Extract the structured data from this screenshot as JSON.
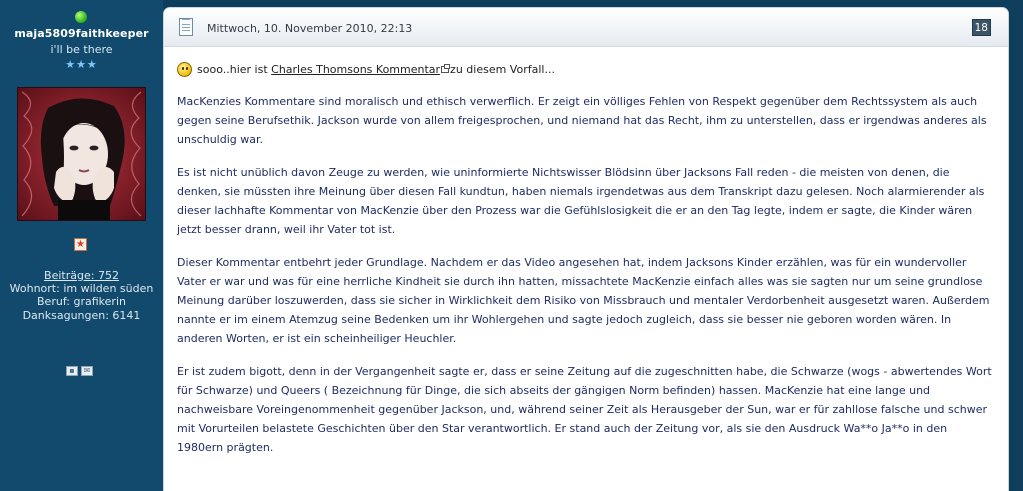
{
  "user": {
    "username": "maja5809faithkeeper",
    "title": "i'll be there",
    "stars": "★★★",
    "posts_label": "Beiträge: 752",
    "location_label": "Wohnort: im wilden süden",
    "job_label": "Beruf: grafikerin",
    "thanks_label": "Danksagungen: 6141",
    "icons": [
      "profile-icon",
      "mail-icon"
    ]
  },
  "post": {
    "date": "Mittwoch, 10. November 2010, 22:13",
    "number": "18",
    "intro_before": "sooo..hier ist ",
    "intro_link": "Charles Thomsons Kommentar",
    "intro_after": "zu diesem Vorfall...",
    "paragraphs": [
      "MacKenzies Kommentare sind moralisch und ethisch verwerflich. Er zeigt ein völliges Fehlen von Respekt gegenüber dem Rechtssystem als auch gegen seine Berufsethik. Jackson wurde von allem freigesprochen, und niemand hat das Recht, ihm zu unterstellen, dass er irgendwas anderes als unschuldig war.",
      "Es ist nicht unüblich davon Zeuge zu werden, wie uninformierte Nichtswisser Blödsinn über Jacksons Fall reden - die meisten von denen, die denken, sie müssten ihre Meinung über diesen Fall kundtun, haben niemals irgendetwas aus dem Transkript dazu gelesen. Noch alarmierender als dieser lachhafte Kommentar von MacKenzie über den Prozess war die Gefühlslosigkeit die er an den Tag legte, indem er sagte, die Kinder wären jetzt besser drann, weil ihr Vater tot ist.",
      "Dieser Kommentar entbehrt jeder Grundlage. Nachdem er das Video angesehen hat, indem Jacksons Kinder erzählen, was für ein wundervoller Vater er war und was für eine herrliche Kindheit sie durch ihn hatten, missachtete MacKenzie einfach alles was sie sagten nur um seine grundlose Meinung darüber loszuwerden, dass sie sicher in Wirklichkeit dem Risiko von Missbrauch und mentaler Verdorbenheit ausgesetzt waren. Außerdem nannte er im einem Atemzug seine Bedenken um ihr Wohlergehen und sagte jedoch zugleich, dass sie besser nie geboren worden wären. In anderen Worten, er ist ein scheinheiliger Heuchler.",
      "Er ist zudem bigott, denn in der Vergangenheit sagte er, dass er seine Zeitung auf die zugeschnitten habe, die Schwarze (wogs - abwertendes Wort für Schwarze) und Queers ( Bezeichnung für Dinge, die sich abseits der gängigen Norm befinden) hassen. MacKenzie hat eine lange und nachweisbare Voreingenommenheit gegenüber Jackson, und, während seiner Zeit als Herausgeber der Sun, war er für zahllose falsche und schwer mit Vorurteilen belastete Geschichten über den Star verantwortlich. Er stand auch der Zeitung vor, als sie den Ausdruck Wa**o Ja**o in den 1980ern prägten."
    ]
  },
  "colors": {
    "sidebar_bg": "#114a6c",
    "post_text": "#1f2c63",
    "post_number_bg": "#3c5467"
  }
}
